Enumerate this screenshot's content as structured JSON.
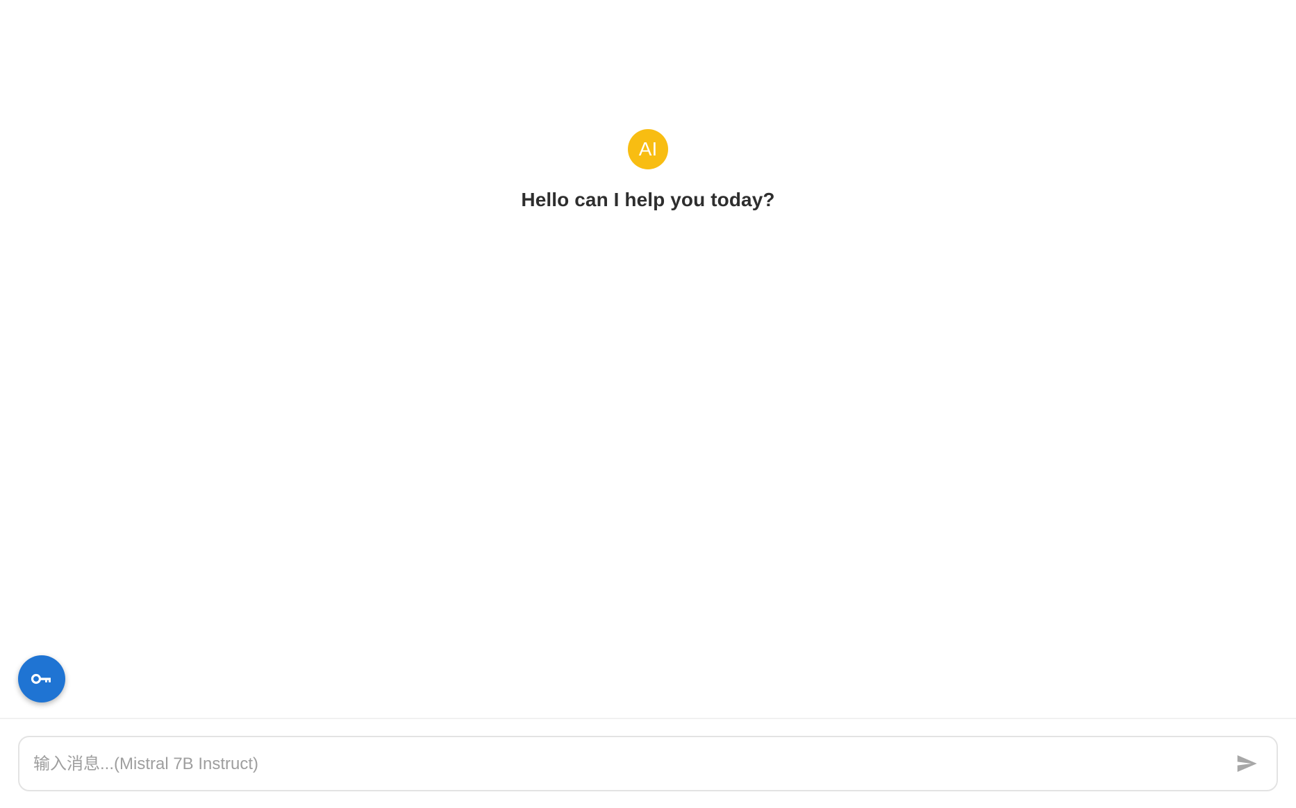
{
  "welcome": {
    "avatar_text": "AI",
    "greeting": "Hello can I help you today?"
  },
  "fab": {
    "icon": "key-icon"
  },
  "composer": {
    "placeholder": "输入消息...(Mistral 7B Instruct)",
    "value": "",
    "send_icon": "send-icon"
  },
  "colors": {
    "avatar_bg": "#f8bd12",
    "fab_bg": "#1f74d3",
    "greeting_text": "#2e2e2e",
    "placeholder_text": "#9e9e9e"
  }
}
